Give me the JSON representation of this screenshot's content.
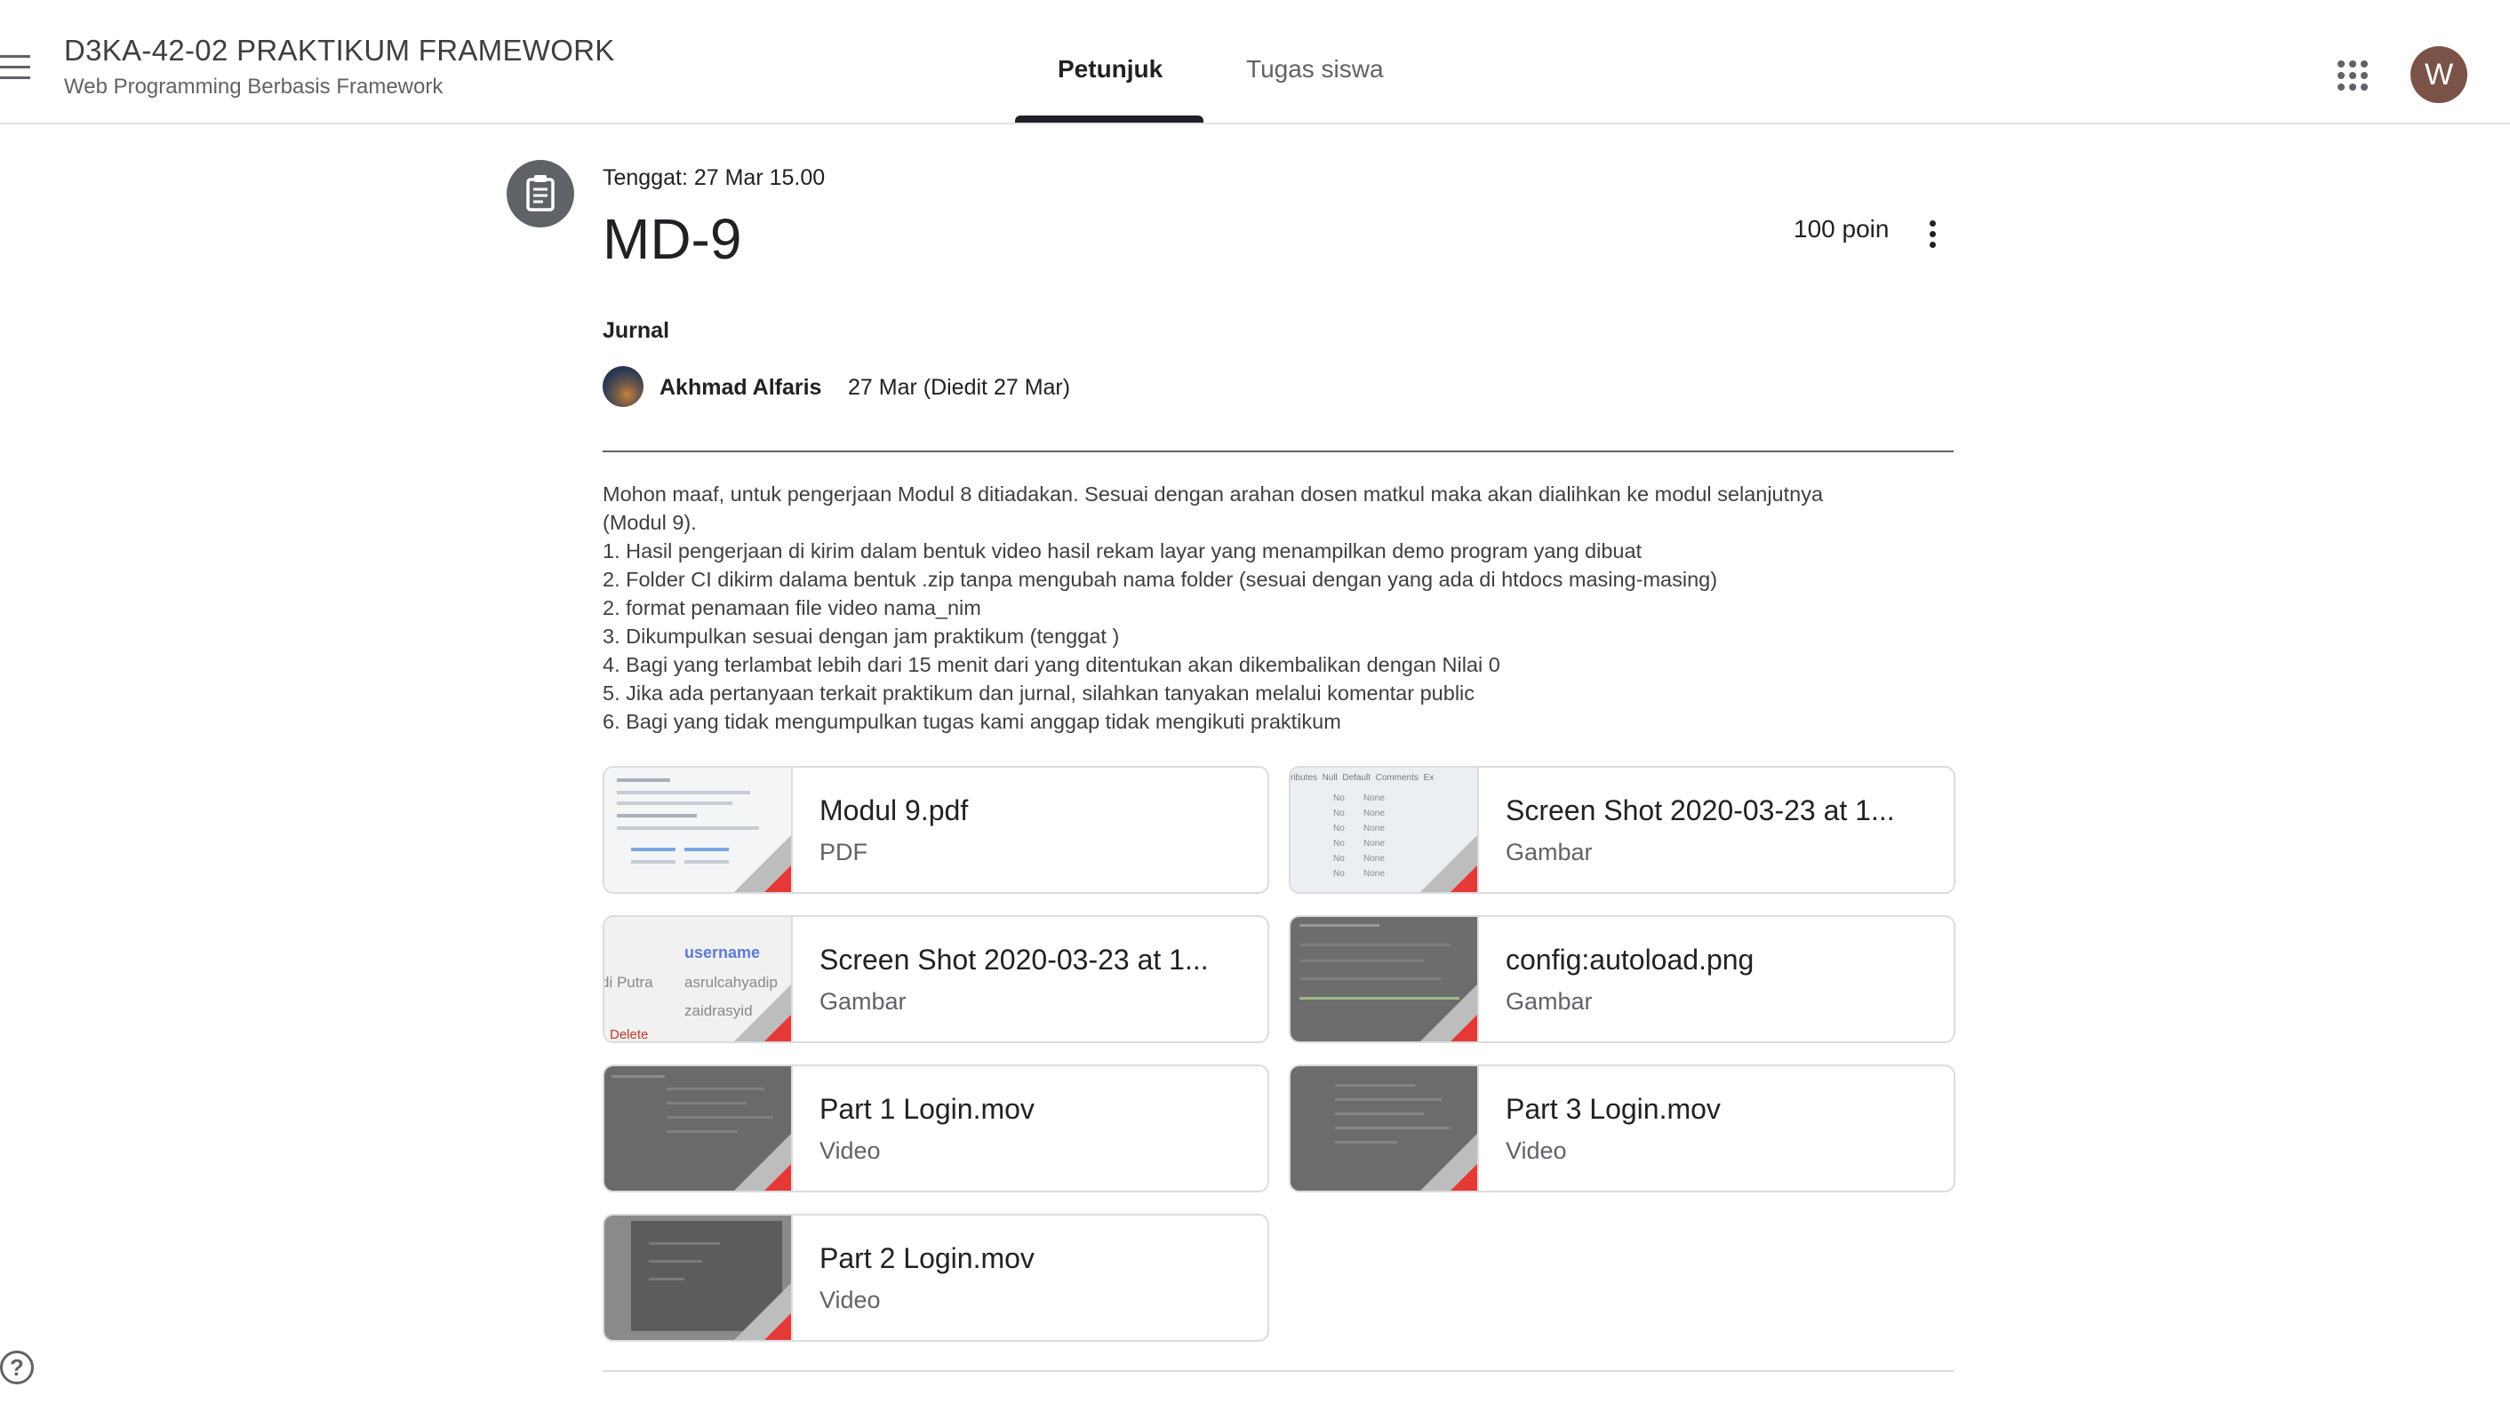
{
  "header": {
    "class_name": "D3KA-42-02 PRAKTIKUM FRAMEWORK",
    "class_subtitle": "Web Programming Berbasis Framework",
    "tabs": [
      {
        "label": "Petunjuk",
        "active": true
      },
      {
        "label": "Tugas siswa",
        "active": false
      }
    ],
    "avatar_letter": "W",
    "avatar_color": "#7b5247"
  },
  "assignment": {
    "icon": "assignment-icon",
    "due": "Tenggat: 27 Mar 15.00",
    "title": "MD-9",
    "points": "100 poin",
    "topic": "Jurnal",
    "author": "Akhmad Alfaris",
    "date": "27 Mar (Diedit 27 Mar)",
    "description": [
      "Mohon maaf, untuk pengerjaan Modul 8 ditiadakan. Sesuai dengan arahan dosen matkul maka akan dialihkan ke modul selanjutnya",
      "(Modul 9).",
      "1. Hasil pengerjaan di kirim dalam bentuk video hasil rekam layar yang menampilkan demo program yang dibuat",
      "2. Folder CI dikirm dalama bentuk .zip tanpa mengubah nama folder (sesuai dengan yang ada di htdocs masing-masing)",
      "2. format penamaan file video nama_nim",
      "3. Dikumpulkan sesuai dengan jam praktikum (tenggat )",
      "4. Bagi yang terlambat lebih dari 15 menit dari yang ditentukan akan dikembalikan dengan Nilai 0",
      "5. Jika ada pertanyaan terkait praktikum dan jurnal, silahkan tanyakan melalui komentar public",
      "6. Bagi yang tidak mengumpulkan tugas kami anggap tidak mengikuti praktikum"
    ]
  },
  "attachments": [
    {
      "title": "Modul 9.pdf",
      "type": "PDF"
    },
    {
      "title": "Screen Shot 2020-03-23 at 1...",
      "type": "Gambar"
    },
    {
      "title": "Screen Shot 2020-03-23 at 1...",
      "type": "Gambar",
      "thumb_text": [
        "username",
        "di Putra",
        "asrulcahyadip",
        "zaidrasyid",
        "Delete"
      ]
    },
    {
      "title": "config:autoload.png",
      "type": "Gambar"
    },
    {
      "title": "Part 1 Login.mov",
      "type": "Video"
    },
    {
      "title": "Part 3 Login.mov",
      "type": "Video"
    },
    {
      "title": "Part 2 Login.mov",
      "type": "Video"
    }
  ],
  "thumb_table_headers": [
    "ributes",
    "Null",
    "Default",
    "Comments",
    "Ex"
  ],
  "thumb_table_cells": [
    "No",
    "None"
  ],
  "help": "?"
}
